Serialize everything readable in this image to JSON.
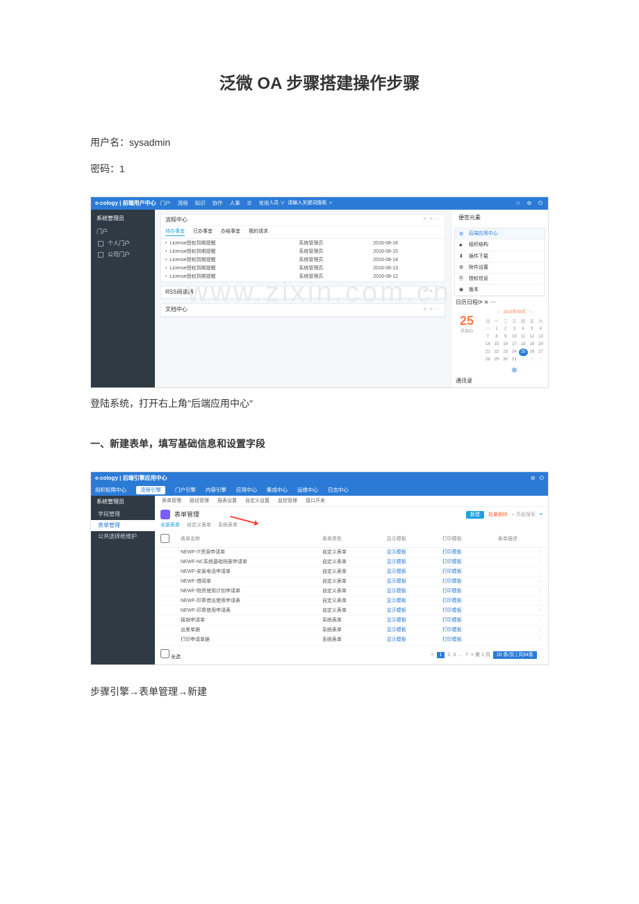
{
  "doc": {
    "title": "泛微 OA 步骤搭建操作步骤",
    "user_line": "用户名：sysadmin",
    "pwd_line": "密码：1",
    "caption1": "登陆系统，打开右上角\"后端应用中心\"",
    "section1": "一、新建表单，填写基础信息和设置字段",
    "end1": "步骤引擎→表单管理→新建",
    "watermark": "www.zixin.com.cn"
  },
  "shot1": {
    "brand": "e-cology | 前端用户中心",
    "topnav": [
      "门户",
      "流程",
      "知识",
      "协作",
      "人事",
      "☰",
      "常用"
    ],
    "searchLabel": "人员 ∨",
    "searchPlaceholder": "请输入关键词搜索",
    "topIcons": [
      "☆",
      "⊖",
      "⏻"
    ],
    "leftUser": "系统管理员",
    "leftSection": "门户",
    "leftItems": [
      "个人门户",
      "公司门户"
    ],
    "flowCard": {
      "title": "流程中心",
      "tabs": [
        "待办事宜",
        "已办事宜",
        "办结事宜",
        "我的请求"
      ],
      "rows": [
        [
          "License授权到期提醒",
          "系统管理员",
          "2016-08-16"
        ],
        [
          "License授权到期提醒",
          "系统管理员",
          "2016-08-15"
        ],
        [
          "License授权到期提醒",
          "系统管理员",
          "2016-08-14"
        ],
        [
          "License授权到期提醒",
          "系统管理员",
          "2016-08-13"
        ],
        [
          "License授权到期提醒",
          "系统管理员",
          "2016-08-12"
        ]
      ]
    },
    "rssTitle": "RSS阅读器",
    "docTitle": "文档中心",
    "rightPanels": {
      "notesTitle": "便签元素",
      "menu": [
        {
          "icon": "⚙",
          "label": "后端应用中心",
          "hl": true
        },
        {
          "icon": "♣",
          "label": "组织结构"
        },
        {
          "icon": "⬇",
          "label": "插件下载"
        },
        {
          "icon": "⚙",
          "label": "附件设置"
        },
        {
          "icon": "🗎",
          "label": "授权信息"
        },
        {
          "icon": "◉",
          "label": "版本"
        }
      ],
      "calTitle": "日历日程",
      "today": "25",
      "todayLbl": "星期四",
      "monthLabel": "2016年08月",
      "wdays": [
        "日",
        "一",
        "二",
        "三",
        "四",
        "五",
        "六"
      ],
      "grid": [
        [
          "31",
          "1",
          "2",
          "3",
          "4",
          "5",
          "6"
        ],
        [
          "7",
          "8",
          "9",
          "10",
          "11",
          "12",
          "13"
        ],
        [
          "14",
          "15",
          "16",
          "17",
          "18",
          "19",
          "20"
        ],
        [
          "21",
          "22",
          "23",
          "24",
          "25",
          "26",
          "27"
        ],
        [
          "28",
          "29",
          "30",
          "31",
          "1",
          "2",
          "3"
        ]
      ],
      "quickTitle": "通讯录"
    }
  },
  "shot2": {
    "brand": "e-cology | 后端引擎应用中心",
    "topnav2": [
      "组织权限中心",
      "流程引擎",
      "门户引擎",
      "内容引擎",
      "应用中心",
      "集成中心",
      "运维中心",
      "日志中心"
    ],
    "subnav": [
      "表单管理",
      "路径管理",
      "报表设置",
      "自定义设置",
      "监控管理",
      "接口开发"
    ],
    "leftUser": "系统管理员",
    "leftItems": [
      "字段管理",
      "表单管理",
      "公共选择框维护"
    ],
    "pageTitle": "表单管理",
    "filterTabs": [
      "全部表单",
      "自定义表单",
      "系统表单"
    ],
    "btnNew": "新建",
    "btnDel": "批量删除",
    "search": "⌕ 高级搜索",
    "thead": [
      "",
      "表单名称",
      "表单类型",
      "显示模板",
      "打印模板",
      "表单描述"
    ],
    "rows": [
      [
        "NEWF-IT资源申请单",
        "自定义表单",
        "显示模板",
        "打印模板"
      ],
      [
        "NEWF-NC系统基础档案申请单",
        "自定义表单",
        "显示模板",
        "打印模板"
      ],
      [
        "NEWF-安装电话申请单",
        "自定义表单",
        "显示模板",
        "打印模板"
      ],
      [
        "NEWF-借阅单",
        "自定义表单",
        "显示模板",
        "打印模板"
      ],
      [
        "NEWF-物资使用计划申请单",
        "自定义表单",
        "显示模板",
        "打印模板"
      ],
      [
        "NEWF-印章借出使用申请表",
        "自定义表单",
        "显示模板",
        "打印模板"
      ],
      [
        "NEWF-印章使用申请表",
        "自定义表单",
        "显示模板",
        "打印模板"
      ],
      [
        "报销申请单",
        "系统表单",
        "显示模板",
        "打印模板"
      ],
      [
        "出差单据",
        "系统表单",
        "显示模板",
        "打印模板"
      ],
      [
        "打印申请单据",
        "系统表单",
        "显示模板",
        "打印模板"
      ]
    ],
    "selectAll": "全选",
    "pager": {
      "pages": [
        "1",
        "2",
        "3",
        "...",
        "7"
      ],
      "go": "> 第 1 页",
      "info": "10 条/页 | 共64条"
    }
  }
}
